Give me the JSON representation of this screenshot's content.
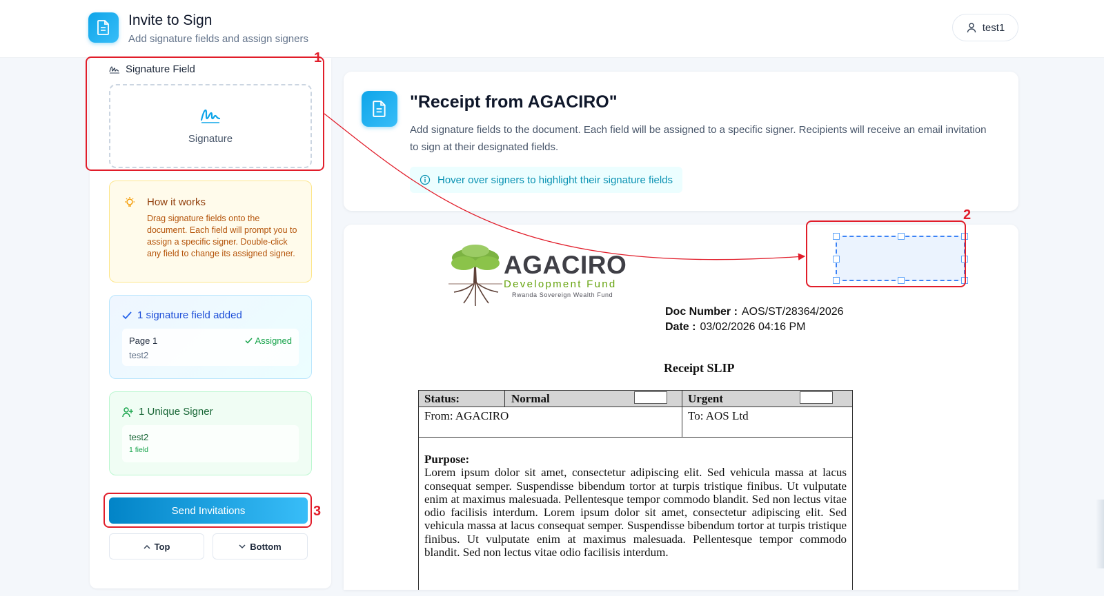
{
  "header": {
    "title": "Invite to Sign",
    "subtitle": "Add signature fields and assign signers",
    "user": "test1"
  },
  "sidebar": {
    "section_label": "Signature Field",
    "tile_label": "Signature",
    "howto": {
      "title": "How it works",
      "text": "Drag signature fields onto the document. Each field will prompt you to assign a specific signer. Double-click any field to change its assigned signer."
    },
    "added": {
      "title": "1 signature field added",
      "page": "Page 1",
      "status": "Assigned",
      "signer": "test2"
    },
    "unique": {
      "title": "1 Unique Signer",
      "name": "test2",
      "count": "1 field"
    },
    "send_label": "Send Invitations",
    "top_label": "Top",
    "bottom_label": "Bottom"
  },
  "doc": {
    "title": "\"Receipt from AGACIRO\"",
    "description": "Add signature fields to the document. Each field will be assigned to a specific signer. Recipients will receive an email invitation to sign at their designated fields.",
    "hint": "Hover over signers to highlight their signature fields"
  },
  "page": {
    "brand_name": "AGACIRO",
    "brand_sub": "Development Fund",
    "brand_sub2": "Rwanda Sovereign Wealth Fund",
    "doc_number_label": "Doc  Number  :",
    "doc_number": "AOS/ST/28364/2026",
    "date_label": "Date  :",
    "date": "03/02/2026 04:16 PM",
    "slip_title": "Receipt SLIP",
    "status_label": "Status:",
    "normal_label": "Normal",
    "urgent_label": "Urgent",
    "from": "From: AGACIRO",
    "to": "To: AOS Ltd",
    "purpose_label": "Purpose:",
    "purpose_text": "Lorem ipsum dolor sit amet, consectetur adipiscing elit. Sed vehicula massa at lacus consequat semper. Suspendisse bibendum tortor at turpis tristique finibus. Ut vulputate enim at maximus malesuada. Pellentesque tempor commodo blandit. Sed non lectus vitae odio facilisis interdum. Lorem ipsum dolor sit amet, consectetur adipiscing elit. Sed vehicula massa at lacus consequat semper. Suspendisse bibendum tortor at turpis tristique finibus. Ut vulputate enim at maximus malesuada. Pellentesque tempor commodo blandit. Sed non lectus vitae odio facilisis interdum."
  },
  "annotations": [
    "1",
    "2",
    "3"
  ],
  "colors": {
    "accent": "#0ea5e9",
    "annotation": "#e11d2a",
    "success": "#16a34a",
    "warning_bg": "#fffbeb"
  },
  "icons": [
    "document-icon",
    "user-icon",
    "signature-icon",
    "lightbulb-icon",
    "check-icon",
    "user-plus-icon",
    "info-icon",
    "chevron-up-icon",
    "chevron-down-icon"
  ]
}
